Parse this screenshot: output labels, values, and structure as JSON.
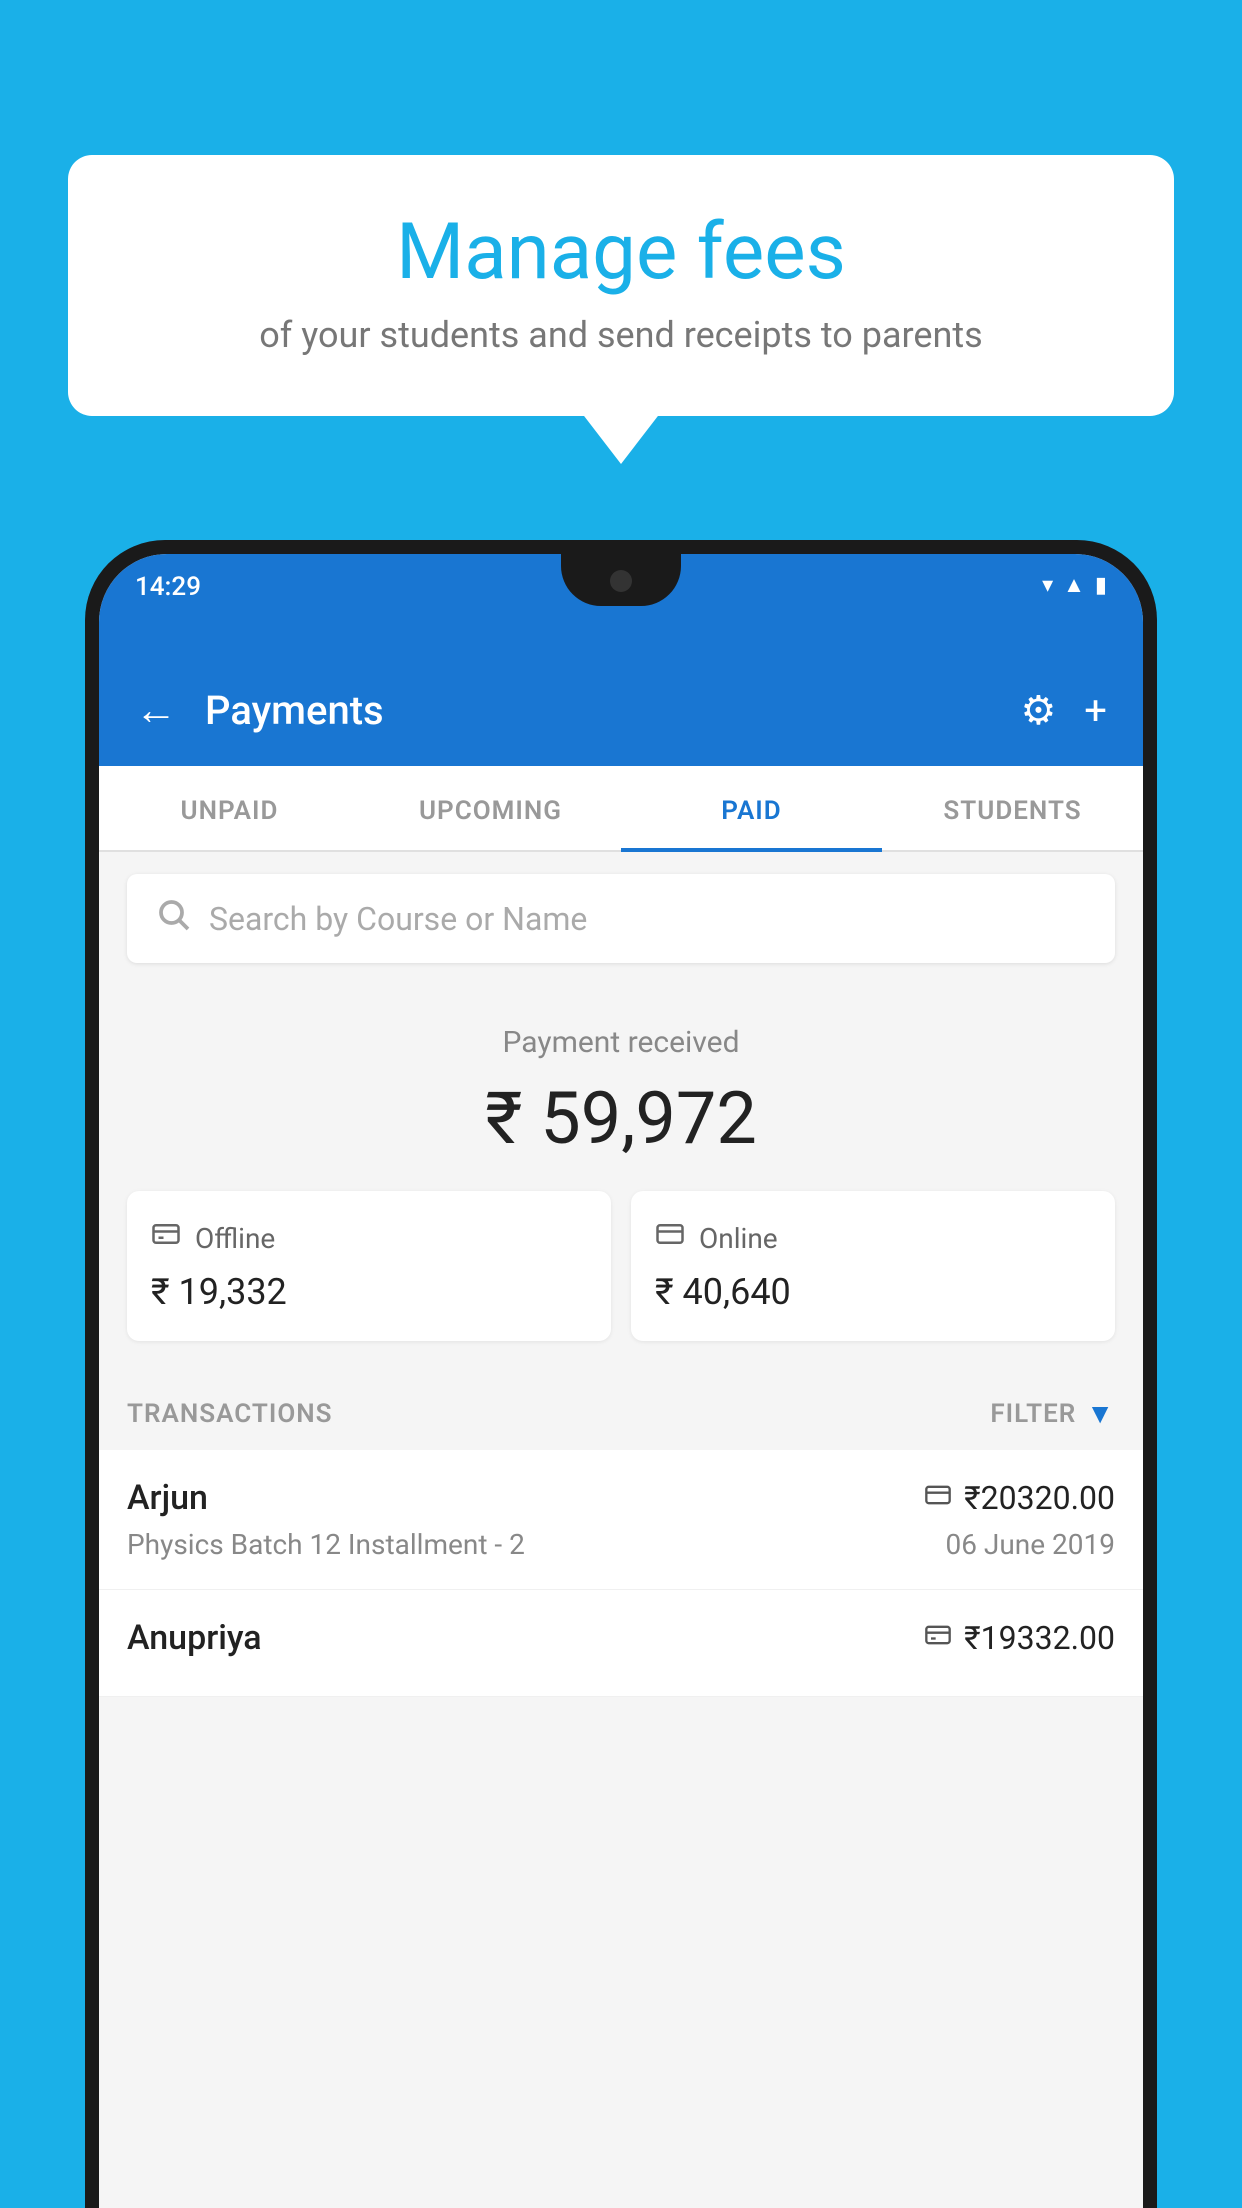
{
  "page": {
    "background_color": "#1ab0e8"
  },
  "bubble": {
    "title": "Manage fees",
    "subtitle": "of your students and send receipts to parents"
  },
  "status_bar": {
    "time": "14:29",
    "icons": [
      "wifi",
      "signal",
      "battery"
    ]
  },
  "app_bar": {
    "title": "Payments",
    "back_icon": "←",
    "settings_icon": "⚙",
    "add_icon": "+"
  },
  "tabs": [
    {
      "label": "UNPAID",
      "active": false
    },
    {
      "label": "UPCOMING",
      "active": false
    },
    {
      "label": "PAID",
      "active": true
    },
    {
      "label": "STUDENTS",
      "active": false
    }
  ],
  "search": {
    "placeholder": "Search by Course or Name"
  },
  "payment_received": {
    "label": "Payment received",
    "amount": "₹ 59,972",
    "offline": {
      "type": "Offline",
      "amount": "₹ 19,332"
    },
    "online": {
      "type": "Online",
      "amount": "₹ 40,640"
    }
  },
  "transactions": {
    "header_label": "TRANSACTIONS",
    "filter_label": "FILTER",
    "items": [
      {
        "name": "Arjun",
        "method_icon": "card",
        "amount": "₹20320.00",
        "course": "Physics Batch 12 Installment - 2",
        "date": "06 June 2019"
      },
      {
        "name": "Anupriya",
        "method_icon": "cash",
        "amount": "₹19332.00",
        "course": "",
        "date": ""
      }
    ]
  }
}
